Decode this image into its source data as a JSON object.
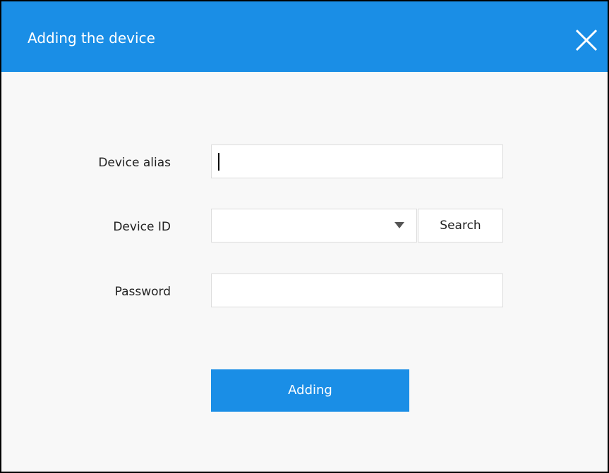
{
  "dialog": {
    "title": "Adding the device",
    "close_icon": "close-icon"
  },
  "form": {
    "alias_label": "Device alias",
    "alias_value": "",
    "device_id_label": "Device ID",
    "device_id_value": "",
    "dropdown_icon": "triangle-down-icon",
    "search_label": "Search",
    "password_label": "Password",
    "password_value": "",
    "submit_label": "Adding"
  },
  "colors": {
    "accent": "#1a8ee6",
    "background": "#f8f8f8",
    "input_border": "#dcdcdc"
  }
}
